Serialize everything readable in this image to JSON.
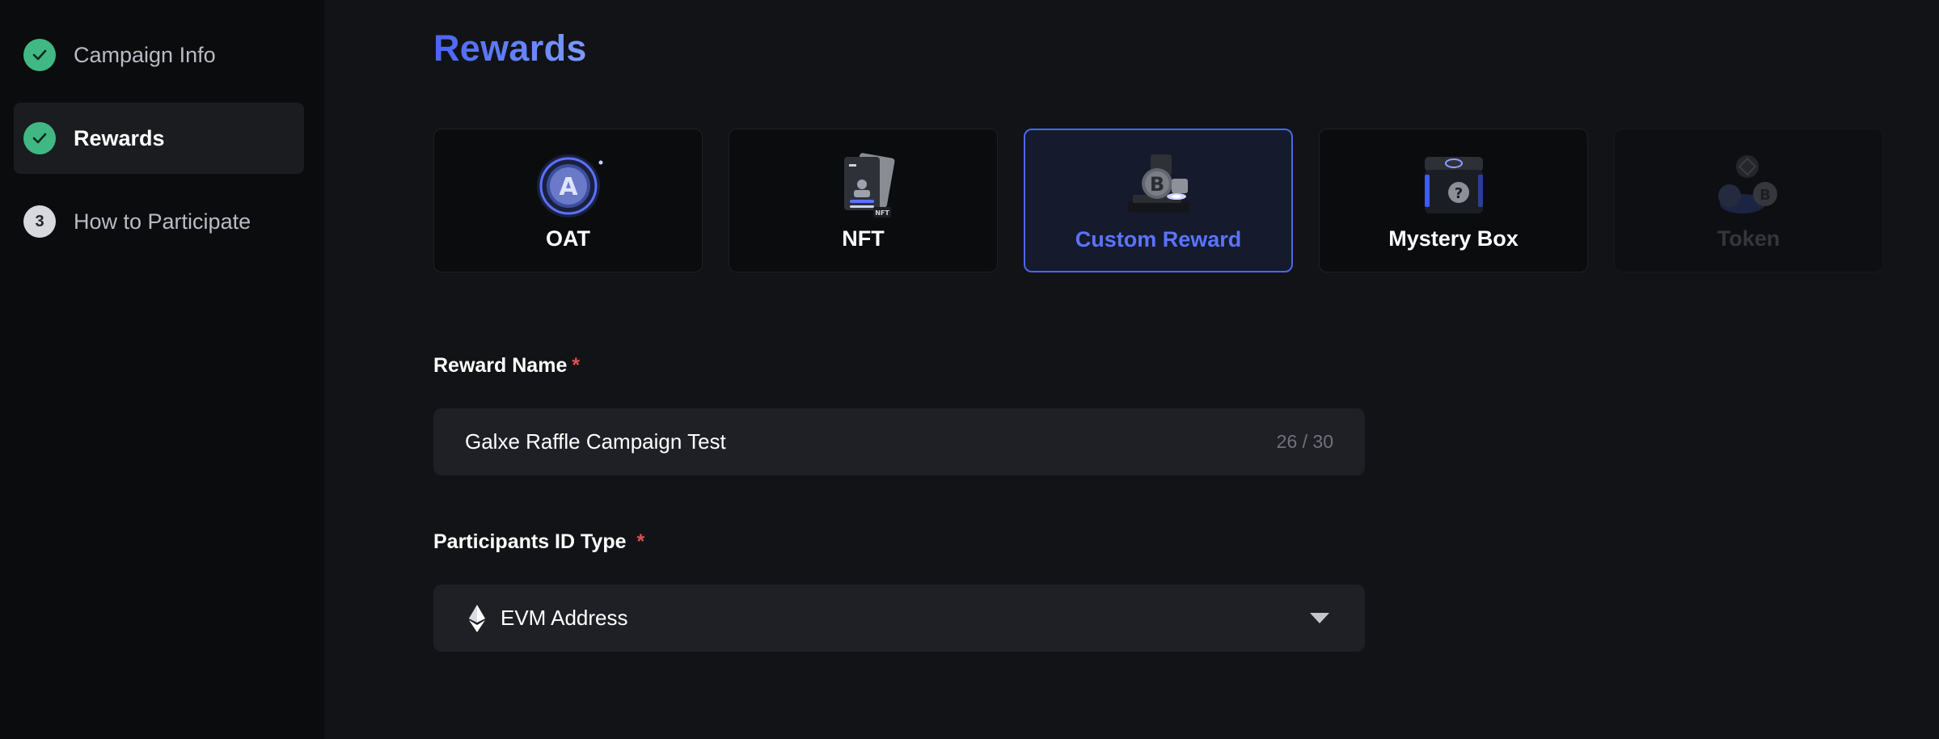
{
  "sidebar": {
    "steps": [
      {
        "label": "Campaign Info",
        "status": "done",
        "icon": "check-icon"
      },
      {
        "label": "Rewards",
        "status": "active",
        "icon": "check-icon"
      },
      {
        "label": "How to Participate",
        "status": "todo",
        "number": "3"
      }
    ]
  },
  "main": {
    "title": "Rewards",
    "reward_types": [
      {
        "label": "OAT",
        "icon": "oat-badge-icon",
        "state": "normal"
      },
      {
        "label": "NFT",
        "icon": "nft-card-icon",
        "state": "normal"
      },
      {
        "label": "Custom Reward",
        "icon": "custom-reward-bitcoin-icon",
        "state": "selected"
      },
      {
        "label": "Mystery Box",
        "icon": "mystery-box-icon",
        "state": "normal"
      },
      {
        "label": "Token",
        "icon": "token-coins-icon",
        "state": "disabled"
      }
    ],
    "reward_name": {
      "label": "Reward Name",
      "required_mark": "*",
      "value": "Galxe Raffle Campaign Test",
      "counter": "26 / 30"
    },
    "participants_id_type": {
      "label": "Participants ID Type",
      "required_mark": "*",
      "value": "EVM Address",
      "icon": "ethereum-icon"
    }
  },
  "colors": {
    "accent": "#4d67e8",
    "success": "#41b883",
    "required": "#e05050",
    "background": "#121317",
    "sidebar": "#0b0c0e"
  }
}
